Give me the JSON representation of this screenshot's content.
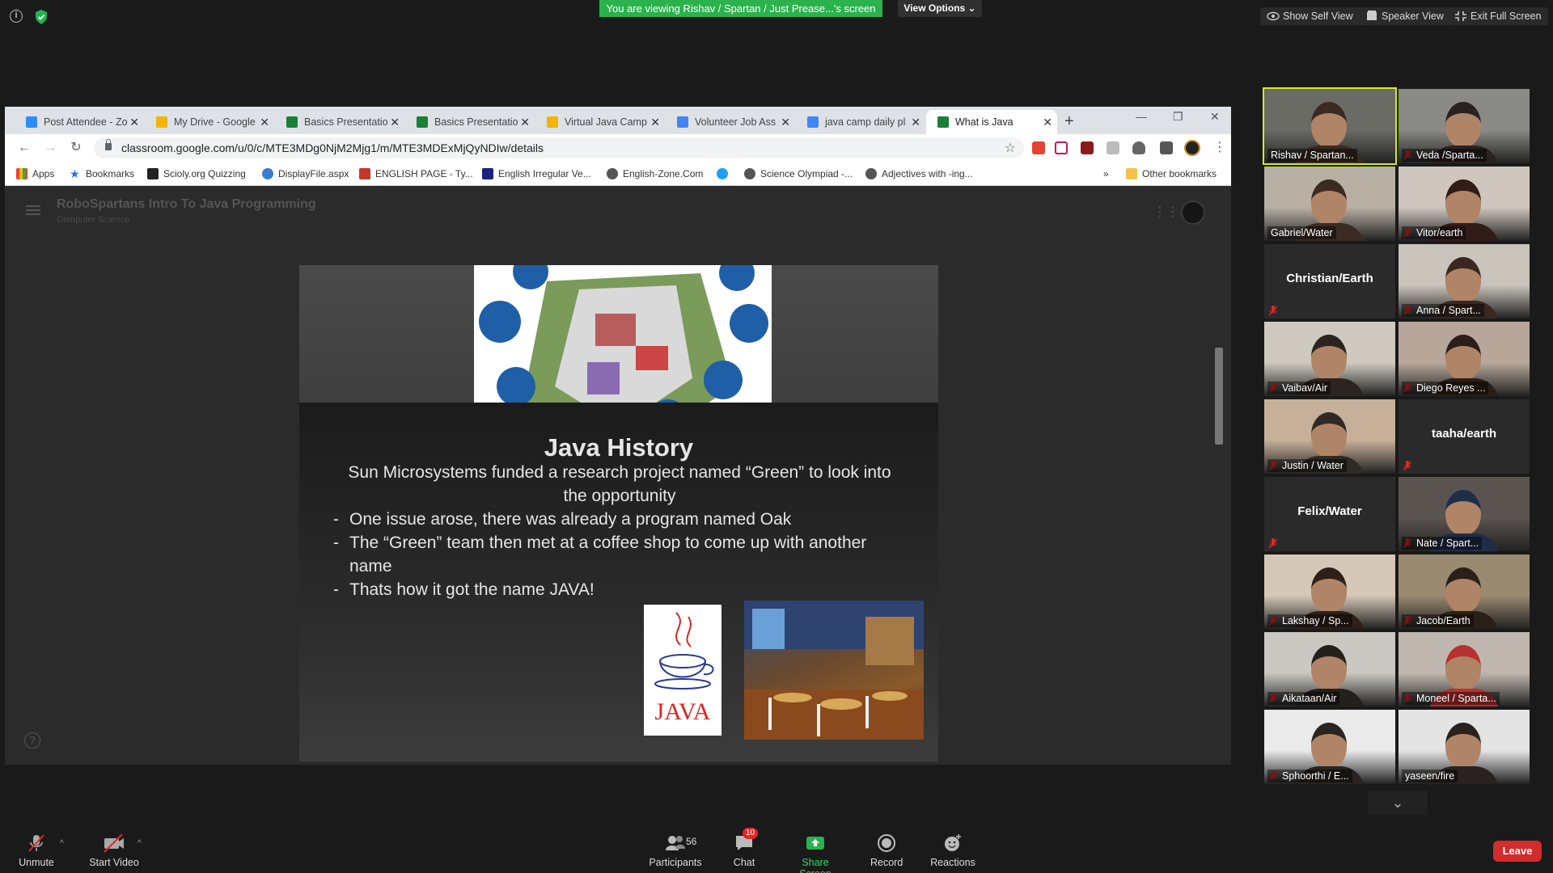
{
  "zoom": {
    "banner": "You are viewing Rishav / Spartan / Just Prease...'s screen",
    "view_options": "View Options",
    "top_buttons": [
      "Show Self View",
      "Speaker View",
      "Exit Full Screen"
    ],
    "toolbar": {
      "unmute": "Unmute",
      "start_video": "Start Video",
      "participants": "Participants",
      "participants_count": "56",
      "chat": "Chat",
      "chat_badge": "10",
      "share_screen": "Share Screen",
      "record": "Record",
      "reactions": "Reactions",
      "leave": "Leave"
    },
    "participants": [
      {
        "name": "Rishav / Spartan...",
        "video": true,
        "muted": false,
        "active": true
      },
      {
        "name": "Veda /Sparta...",
        "video": true,
        "muted": true
      },
      {
        "name": "Gabriel/Water",
        "video": true,
        "muted": false
      },
      {
        "name": "Vitor/earth",
        "video": true,
        "muted": true
      },
      {
        "name": "Christian/Earth",
        "video": false,
        "muted": true
      },
      {
        "name": "Anna / Spart...",
        "video": true,
        "muted": true
      },
      {
        "name": "Vaibav/Air",
        "video": true,
        "muted": true
      },
      {
        "name": "Diego Reyes ...",
        "video": true,
        "muted": true
      },
      {
        "name": "Justin / Water",
        "video": true,
        "muted": true
      },
      {
        "name": "taaha/earth",
        "video": false,
        "muted": true
      },
      {
        "name": "Felix/Water",
        "video": false,
        "muted": true
      },
      {
        "name": "Nate / Spart...",
        "video": true,
        "muted": true
      },
      {
        "name": "Lakshay / Sp...",
        "video": true,
        "muted": true
      },
      {
        "name": "Jacob/Earth",
        "video": true,
        "muted": true
      },
      {
        "name": "Aikataan/Air",
        "video": true,
        "muted": true
      },
      {
        "name": "Moneel / Sparta...",
        "video": true,
        "muted": true
      },
      {
        "name": "Sphoorthi / E...",
        "video": true,
        "muted": true
      },
      {
        "name": "yaseen/fire",
        "video": true,
        "muted": false
      }
    ]
  },
  "browser": {
    "tabs": [
      {
        "title": "Post Attendee - Zo",
        "color": "#2d8cff"
      },
      {
        "title": "My Drive - Google",
        "color": "#f4b400"
      },
      {
        "title": "Basics Presentatio",
        "color": "#188038"
      },
      {
        "title": "Basics Presentatio",
        "color": "#188038"
      },
      {
        "title": "Virtual Java Camp",
        "color": "#f4b400"
      },
      {
        "title": "Volunteer Job Ass",
        "color": "#4285f4"
      },
      {
        "title": "java camp daily pl",
        "color": "#4285f4"
      },
      {
        "title": "What is Java",
        "color": "#188038"
      }
    ],
    "url": "classroom.google.com/u/0/c/MTE3MDg0NjM2Mjg1/m/MTE3MDExMjQyNDIw/details",
    "bookmarks": [
      {
        "label": "Apps",
        "color": "#4285f4"
      },
      {
        "label": "Bookmarks",
        "color": "#1a73e8"
      },
      {
        "label": "Scioly.org Quizzing",
        "color": "#222"
      },
      {
        "label": "DisplayFile.aspx",
        "color": "#3a7bd5"
      },
      {
        "label": "ENGLISH PAGE - Ty...",
        "color": "#c0392b"
      },
      {
        "label": "English Irregular Ve...",
        "color": "#1a237e"
      },
      {
        "label": "English-Zone.Com",
        "color": "#555"
      },
      {
        "label": "",
        "color": "#1da1f2"
      },
      {
        "label": "Science Olympiad -...",
        "color": "#555"
      },
      {
        "label": "Adjectives with -ing...",
        "color": "#555"
      }
    ],
    "other_bookmarks": "Other bookmarks",
    "classroom": {
      "title": "RoboSpartans Intro To Java Programming",
      "subtitle": "Computer Science"
    }
  },
  "slide": {
    "title": "Java History",
    "intro": "Sun Microsystems funded a research project named “Green” to look into the opportunity",
    "bullets": [
      "One issue arose, there was already a program named Oak",
      "The “Green” team then met at a coffee shop to come up with another name",
      "Thats how it got the name JAVA!"
    ],
    "logo_text": "JAVA"
  }
}
